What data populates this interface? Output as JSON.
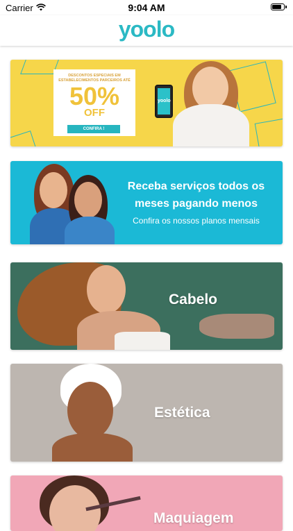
{
  "status_bar": {
    "carrier": "Carrier",
    "time": "9:04 AM"
  },
  "header": {
    "logo": "yoolo"
  },
  "cards": [
    {
      "id": "promo",
      "small_text": "DESCONTOS ESPECIAIS EM ESTABELECIMENTOS PARCEIROS ATÉ",
      "discount": "50%",
      "off": "OFF",
      "button": "CONFIRA !",
      "phone_logo": "yoolo"
    },
    {
      "id": "plans",
      "title": "Receba serviços todos os meses pagando menos",
      "subtitle": "Confira os nossos planos mensais"
    },
    {
      "id": "cabelo",
      "label": "Cabelo"
    },
    {
      "id": "estetica",
      "label": "Estética"
    },
    {
      "id": "maquiagem",
      "label": "Maquiagem"
    }
  ],
  "colors": {
    "brand": "#2bb9c4",
    "promo_bg": "#f6d64a",
    "plans_bg": "#1bb9d6",
    "cabelo_bg": "#3c6f5e",
    "estetica_bg": "#bdb6b0",
    "maquiagem_bg": "#f1a7b7"
  }
}
